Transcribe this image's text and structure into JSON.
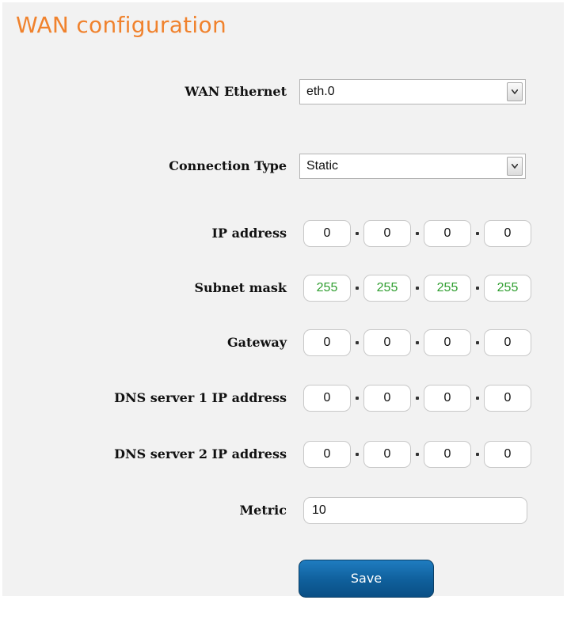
{
  "page": {
    "title": "WAN configuration"
  },
  "wan_ethernet": {
    "label": "WAN Ethernet",
    "value": "eth.0"
  },
  "connection_type": {
    "label": "Connection Type",
    "value": "Static"
  },
  "ip_address": {
    "label": "IP address",
    "octets": [
      "0",
      "0",
      "0",
      "0"
    ]
  },
  "subnet_mask": {
    "label": "Subnet mask",
    "octets": [
      "255",
      "255",
      "255",
      "255"
    ]
  },
  "gateway": {
    "label": "Gateway",
    "octets": [
      "0",
      "0",
      "0",
      "0"
    ]
  },
  "dns1": {
    "label": "DNS server 1 IP address",
    "octets": [
      "0",
      "0",
      "0",
      "0"
    ]
  },
  "dns2": {
    "label": "DNS server 2 IP address",
    "octets": [
      "0",
      "0",
      "0",
      "0"
    ]
  },
  "metric": {
    "label": "Metric",
    "value": "10"
  },
  "actions": {
    "save_label": "Save"
  },
  "colors": {
    "title": "#f0822d",
    "button": "#0f5f9b",
    "subnet_text": "#2f9e2f",
    "panel_bg": "#f2f2f2"
  }
}
